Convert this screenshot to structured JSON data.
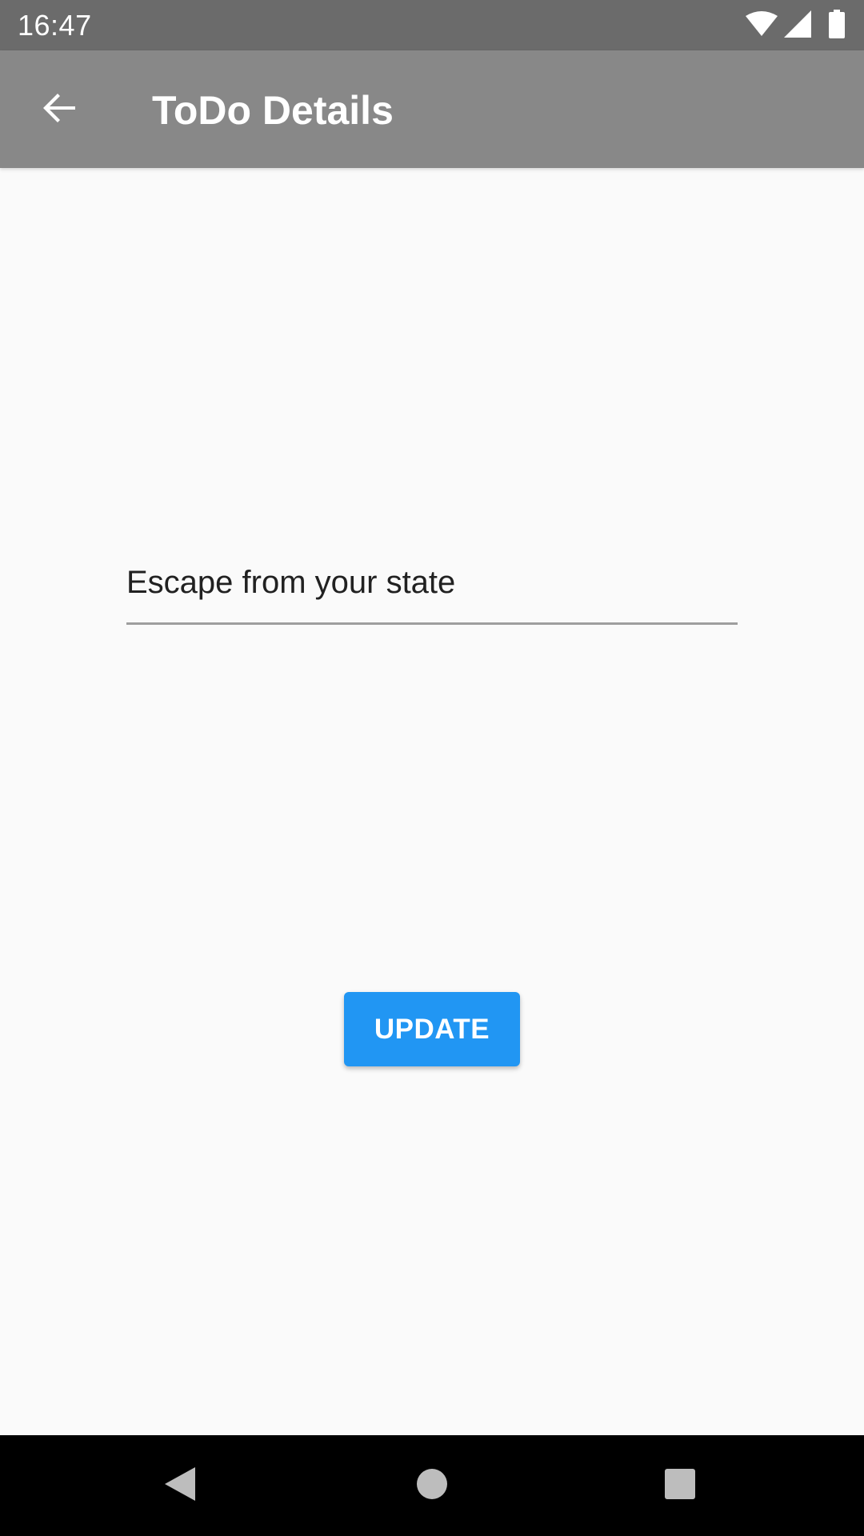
{
  "status_bar": {
    "time": "16:47",
    "icons": [
      "wifi-icon",
      "signal-icon",
      "battery-icon"
    ]
  },
  "app_bar": {
    "title": "ToDo Details",
    "back_icon": "arrow-back-icon",
    "background": "#888888"
  },
  "todo": {
    "value": "Escape from your state"
  },
  "update_button": {
    "label": "UPDATE",
    "color": "#2196f3"
  },
  "nav_bar": {
    "icons": [
      "back-triangle-icon",
      "home-circle-icon",
      "recents-square-icon"
    ]
  }
}
